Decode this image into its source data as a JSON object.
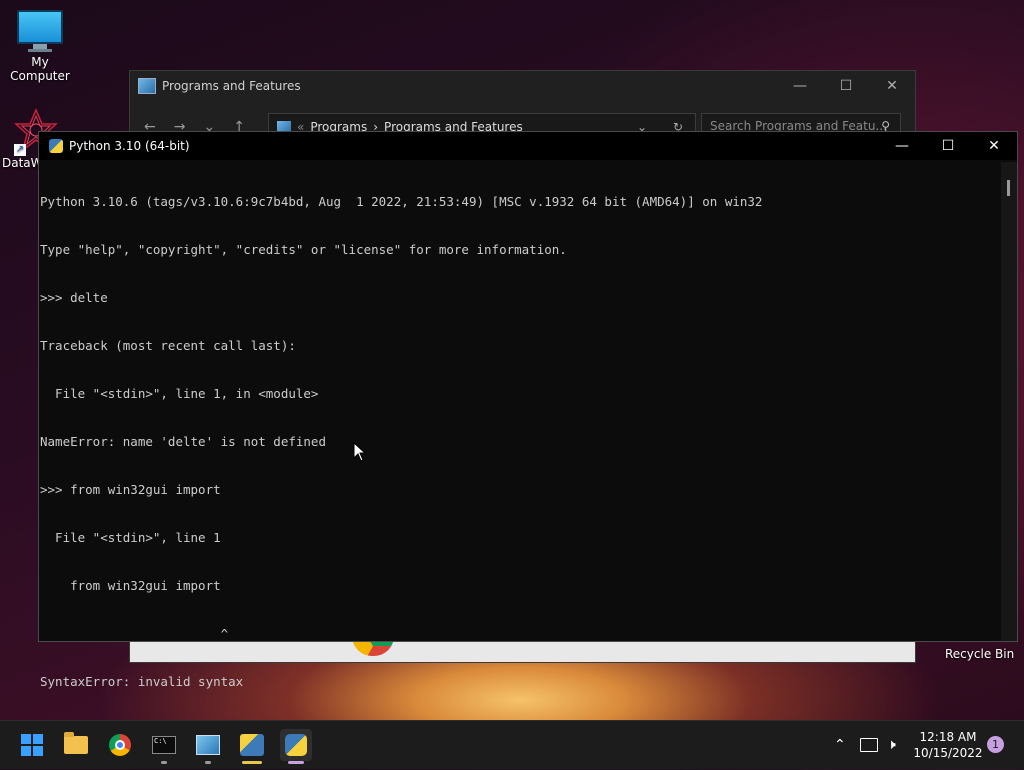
{
  "desktop": {
    "my_computer_label": "My Computer",
    "dataw_label": "DataW",
    "recycle_bin_label": "Recycle Bin"
  },
  "programs_window": {
    "title": "Programs and Features",
    "breadcrumb_sep": "«",
    "breadcrumb_1": "Programs",
    "breadcrumb_arrow": "›",
    "breadcrumb_2": "Programs and Features",
    "search_placeholder": "Search Programs and Featu..."
  },
  "python_window": {
    "title": "Python 3.10 (64-bit)",
    "console_lines": [
      "Python 3.10.6 (tags/v3.10.6:9c7b4bd, Aug  1 2022, 21:53:49) [MSC v.1932 64 bit (AMD64)] on win32",
      "Type \"help\", \"copyright\", \"credits\" or \"license\" for more information.",
      ">>> delte",
      "Traceback (most recent call last):",
      "  File \"<stdin>\", line 1, in <module>",
      "NameError: name 'delte' is not defined",
      ">>> from win32gui import",
      "  File \"<stdin>\", line 1",
      "    from win32gui import",
      "                        ^",
      "SyntaxError: invalid syntax",
      ">>>"
    ]
  },
  "taskbar": {
    "clock_time": "12:18 AM",
    "clock_date": "10/15/2022",
    "notification_count": "1"
  },
  "colors": {
    "console_text": "#cccccc",
    "console_bg": "#0c0c0c",
    "accent_indicator": "#e8c64a"
  }
}
